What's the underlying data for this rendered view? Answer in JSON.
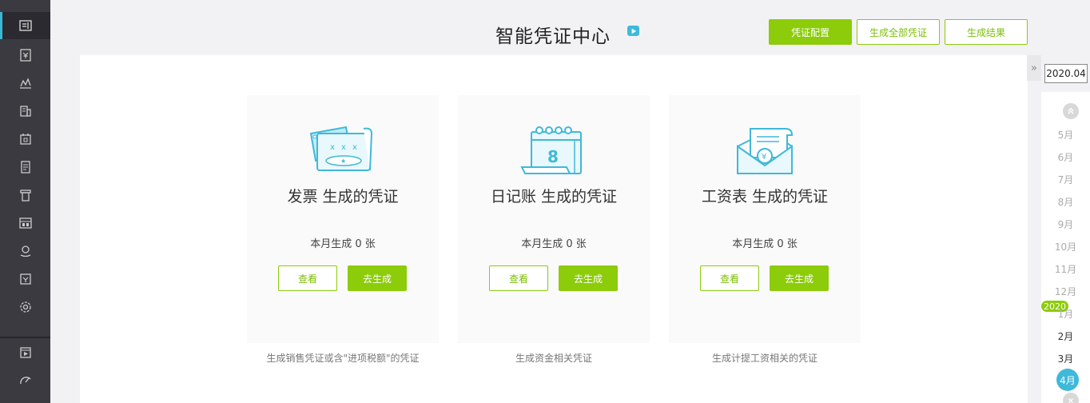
{
  "header": {
    "title": "智能凭证中心",
    "buttons": {
      "config": "凭证配置",
      "generate_all": "生成全部凭证",
      "results": "生成结果"
    }
  },
  "leftnav": {
    "icons": [
      "document-list-icon",
      "yen-voucher-icon",
      "line-chart-icon",
      "building-icon",
      "calendar-icon",
      "ledger-icon",
      "invoice-icon",
      "report-icon",
      "stamp-icon",
      "tax-form-icon",
      "settings-icon",
      "video-tutorial-icon",
      "speed-gauge-icon"
    ]
  },
  "cards": [
    {
      "icon": "invoice-ticket-icon",
      "title": "发票 生成的凭证",
      "count_text": "本月生成 0 张",
      "view_label": "查看",
      "generate_label": "去生成",
      "description": "生成销售凭证或含\"进项税额\"的凭证"
    },
    {
      "icon": "journal-notebook-icon",
      "title": "日记账 生成的凭证",
      "count_text": "本月生成 0 张",
      "view_label": "查看",
      "generate_label": "去生成",
      "description": "生成资金相关凭证"
    },
    {
      "icon": "salary-envelope-icon",
      "title": "工资表 生成的凭证",
      "count_text": "本月生成 0 张",
      "view_label": "查看",
      "generate_label": "去生成",
      "description": "生成计提工资相关的凭证"
    }
  ],
  "period": {
    "value": "2020.04",
    "months_prev_year": [
      "5月",
      "6月",
      "7月",
      "8月",
      "9月",
      "10月",
      "11月",
      "12月"
    ],
    "year_label": "2020",
    "months_current_year": [
      "1月",
      "2月",
      "3月"
    ],
    "selected_month": "4月"
  },
  "colors": {
    "accent_green": "#8ccc0a",
    "accent_blue": "#3fb9da",
    "nav_bg": "#3a3a40"
  }
}
